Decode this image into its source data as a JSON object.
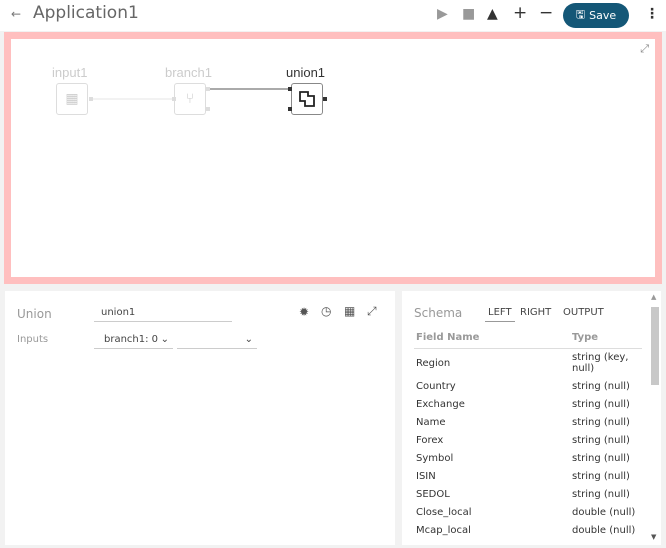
{
  "header": {
    "title": "Application1",
    "save_label": "Save"
  },
  "nodes": [
    {
      "label": "input1"
    },
    {
      "label": "branch1"
    },
    {
      "label": "union1"
    }
  ],
  "properties": {
    "type_label": "Union",
    "name_value": "union1",
    "inputs_label": "Inputs",
    "input1_value": "branch1: 0",
    "input2_value": ""
  },
  "schema": {
    "title": "Schema",
    "tabs": [
      "LEFT",
      "RIGHT",
      "OUTPUT"
    ],
    "active_tab": "LEFT",
    "columns": [
      "Field Name",
      "Type"
    ],
    "rows": [
      [
        "Region",
        "string (key, null)"
      ],
      [
        "Country",
        "string (null)"
      ],
      [
        "Exchange",
        "string (null)"
      ],
      [
        "Name",
        "string (null)"
      ],
      [
        "Forex",
        "string (null)"
      ],
      [
        "Symbol",
        "string (null)"
      ],
      [
        "ISIN",
        "string (null)"
      ],
      [
        "SEDOL",
        "string (null)"
      ],
      [
        "Close_local",
        "double (null)"
      ],
      [
        "Mcap_local",
        "double (null)"
      ]
    ]
  },
  "colors": {
    "accent": "#145777",
    "canvas_border": "#ffbfbf"
  }
}
